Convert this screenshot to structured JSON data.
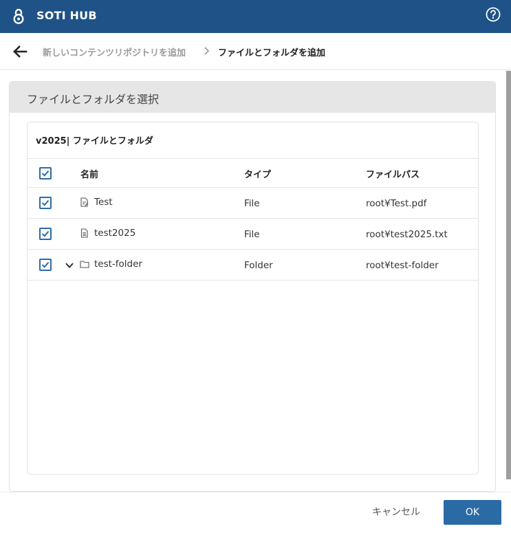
{
  "header": {
    "app_title": "SOTI HUB",
    "brand_color": "#1f5387",
    "logo_icon": "soti-logo-icon",
    "help_icon": "help-circle-icon"
  },
  "breadcrumb": {
    "back_icon": "arrow-left-icon",
    "parent": "新しいコンテンツリポジトリを追加",
    "separator_icon": "chevron-right-icon",
    "current": "ファイルとフォルダを追加"
  },
  "panel": {
    "title": "ファイルとフォルダを選択",
    "card_title": "v2025| ファイルとフォルダ",
    "columns": {
      "name": "名前",
      "type": "タイプ",
      "path": "ファイルパス"
    },
    "select_all_checked": true,
    "rows": [
      {
        "name": "Test",
        "type": "File",
        "path": "root¥Test.pdf",
        "icon": "pdf-file-icon",
        "checked": true
      },
      {
        "name": "test2025",
        "type": "File",
        "path": "root¥test2025.txt",
        "icon": "text-file-icon",
        "checked": true
      },
      {
        "name": "test-folder",
        "type": "Folder",
        "path": "root¥test-folder",
        "icon": "folder-icon",
        "checked": true,
        "expandable": true
      }
    ]
  },
  "footer": {
    "cancel_label": "キャンセル",
    "ok_label": "OK",
    "accent_color": "#2a6aa5"
  }
}
